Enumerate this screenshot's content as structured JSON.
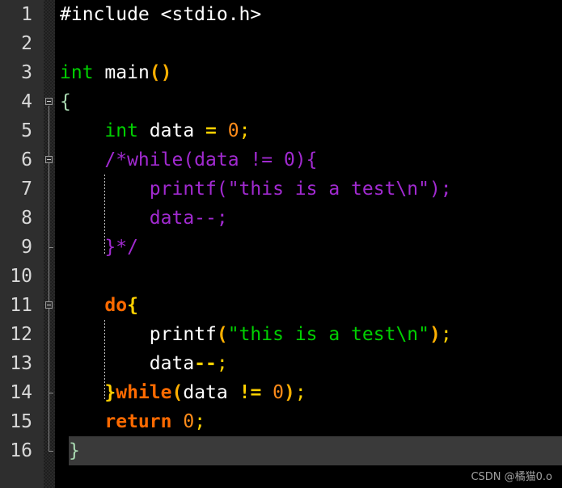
{
  "editor": {
    "background": "#000000",
    "gutter_background": "#2e2e2e",
    "highlight_color": "#3a3a3a",
    "line_count": 16
  },
  "line_numbers": [
    "1",
    "2",
    "3",
    "4",
    "5",
    "6",
    "7",
    "8",
    "9",
    "10",
    "11",
    "12",
    "13",
    "14",
    "15",
    "16"
  ],
  "code_lines": [
    {
      "n": "1",
      "indent": 0,
      "tokens": [
        {
          "text": "#include <stdio.h>",
          "style": "t-plain"
        }
      ]
    },
    {
      "n": "2",
      "indent": 0,
      "tokens": []
    },
    {
      "n": "3",
      "indent": 0,
      "tokens": [
        {
          "text": "int",
          "style": "t-kw"
        },
        {
          "text": " ",
          "style": "t-plain"
        },
        {
          "text": "main",
          "style": "t-plain"
        },
        {
          "text": "()",
          "style": "t-paren"
        }
      ]
    },
    {
      "n": "4",
      "indent": 0,
      "tokens": [
        {
          "text": "{",
          "style": "t-cbrace"
        }
      ]
    },
    {
      "n": "5",
      "indent": 0,
      "tokens": [
        {
          "text": "    ",
          "style": "t-plain"
        },
        {
          "text": "int",
          "style": "t-kw"
        },
        {
          "text": " data ",
          "style": "t-plain"
        },
        {
          "text": "=",
          "style": "t-op"
        },
        {
          "text": " ",
          "style": "t-plain"
        },
        {
          "text": "0",
          "style": "t-num"
        },
        {
          "text": ";",
          "style": "t-semi"
        }
      ]
    },
    {
      "n": "6",
      "indent": 0,
      "tokens": [
        {
          "text": "    /*while(data != 0){",
          "style": "t-comment"
        }
      ]
    },
    {
      "n": "7",
      "indent": 0,
      "tokens": [
        {
          "text": "        printf(\"this is a test\\n\");",
          "style": "t-comment"
        }
      ]
    },
    {
      "n": "8",
      "indent": 0,
      "tokens": [
        {
          "text": "        data--;",
          "style": "t-comment"
        }
      ]
    },
    {
      "n": "9",
      "indent": 0,
      "tokens": [
        {
          "text": "    }*/",
          "style": "t-comment"
        }
      ]
    },
    {
      "n": "10",
      "indent": 0,
      "tokens": []
    },
    {
      "n": "11",
      "indent": 0,
      "tokens": [
        {
          "text": "    ",
          "style": "t-plain"
        },
        {
          "text": "do",
          "style": "t-kwb"
        },
        {
          "text": "{",
          "style": "t-brace"
        }
      ]
    },
    {
      "n": "12",
      "indent": 0,
      "tokens": [
        {
          "text": "        ",
          "style": "t-plain"
        },
        {
          "text": "printf",
          "style": "t-plain"
        },
        {
          "text": "(",
          "style": "t-paren"
        },
        {
          "text": "\"this is a test\\n\"",
          "style": "t-str"
        },
        {
          "text": ")",
          "style": "t-paren"
        },
        {
          "text": ";",
          "style": "t-semi"
        }
      ]
    },
    {
      "n": "13",
      "indent": 0,
      "tokens": [
        {
          "text": "        data",
          "style": "t-plain"
        },
        {
          "text": "--",
          "style": "t-op"
        },
        {
          "text": ";",
          "style": "t-semi"
        }
      ]
    },
    {
      "n": "14",
      "indent": 0,
      "tokens": [
        {
          "text": "    ",
          "style": "t-plain"
        },
        {
          "text": "}",
          "style": "t-brace"
        },
        {
          "text": "while",
          "style": "t-kwb"
        },
        {
          "text": "(",
          "style": "t-paren"
        },
        {
          "text": "data",
          "style": "t-plain"
        },
        {
          "text": " ",
          "style": "t-plain"
        },
        {
          "text": "!=",
          "style": "t-op"
        },
        {
          "text": " ",
          "style": "t-plain"
        },
        {
          "text": "0",
          "style": "t-num"
        },
        {
          "text": ")",
          "style": "t-paren"
        },
        {
          "text": ";",
          "style": "t-semi"
        }
      ]
    },
    {
      "n": "15",
      "indent": 0,
      "tokens": [
        {
          "text": "    ",
          "style": "t-plain"
        },
        {
          "text": "return",
          "style": "t-kwb"
        },
        {
          "text": " ",
          "style": "t-plain"
        },
        {
          "text": "0",
          "style": "t-num"
        },
        {
          "text": ";",
          "style": "t-semi"
        }
      ]
    },
    {
      "n": "16",
      "indent": 0,
      "highlighted": true,
      "tokens": [
        {
          "text": "}",
          "style": "t-cbrace"
        }
      ]
    }
  ],
  "fold_markers": [
    {
      "line": 4,
      "type": "minus"
    },
    {
      "line": 6,
      "type": "minus"
    },
    {
      "line": 11,
      "type": "minus"
    }
  ],
  "fold_regions": [
    {
      "from_line": 4,
      "to_line": 16
    },
    {
      "from_line": 6,
      "to_line": 9
    },
    {
      "from_line": 11,
      "to_line": 14
    }
  ],
  "indent_guides": [
    {
      "from_line": 7,
      "to_line": 9,
      "indent": 4
    },
    {
      "from_line": 12,
      "to_line": 14,
      "indent": 4
    }
  ],
  "watermark": {
    "text": "CSDN @橘猫0.o"
  }
}
